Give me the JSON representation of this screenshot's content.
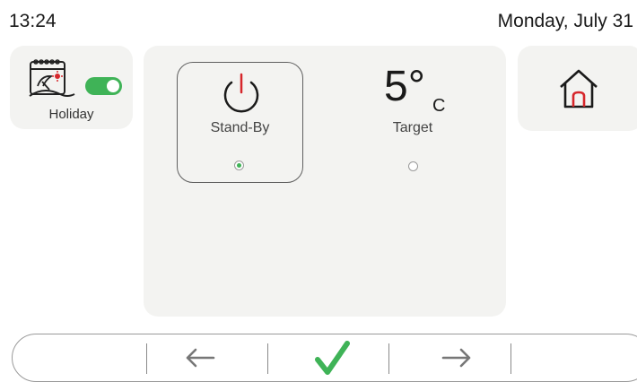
{
  "status": {
    "time": "13:24",
    "date": "Monday, July 31"
  },
  "holiday": {
    "label": "Holiday",
    "toggle_on": true,
    "icon": "calendar-beach-icon",
    "toggle_color": "#3fb357"
  },
  "modes": {
    "standby": {
      "label": "Stand-By",
      "selected": true,
      "icon": "power-icon",
      "accent": "#d6262b"
    },
    "target": {
      "value": "5°",
      "unit": "C",
      "label": "Target",
      "selected": false
    }
  },
  "home": {
    "icon": "home-icon",
    "accent": "#d6262b"
  },
  "nav": {
    "back_icon": "arrow-left-icon",
    "confirm_icon": "checkmark-icon",
    "forward_icon": "arrow-right-icon",
    "confirm_color": "#3fb357"
  }
}
